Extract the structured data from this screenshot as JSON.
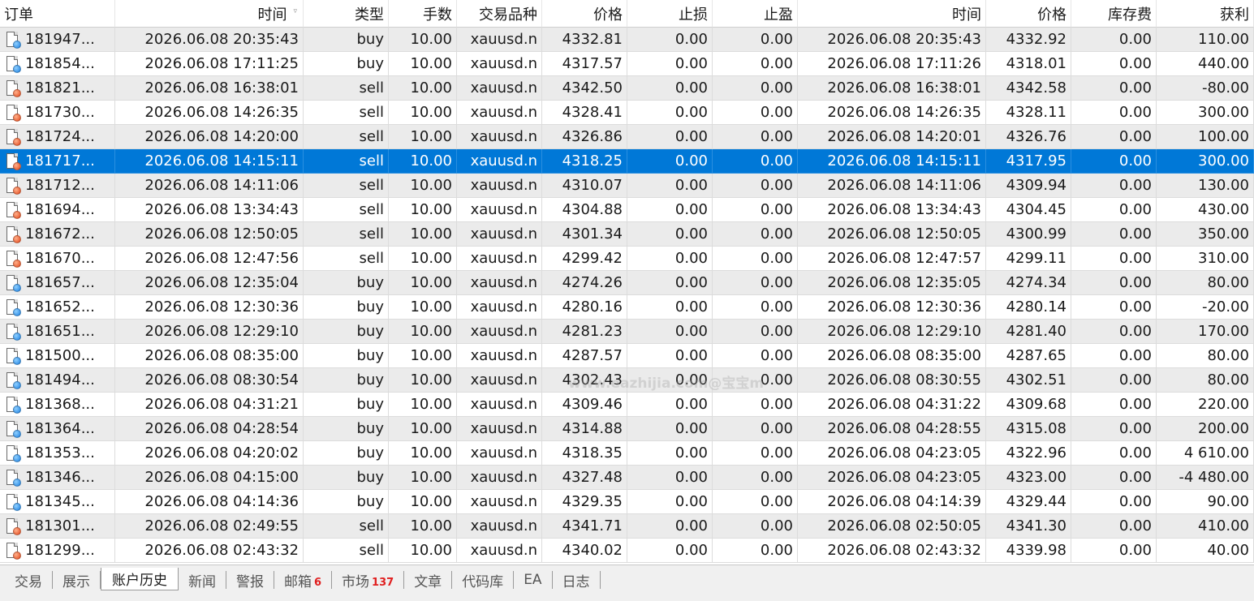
{
  "columns": [
    {
      "key": "order",
      "label": "订单",
      "name": "column-header-order"
    },
    {
      "key": "open_time",
      "label": "时间",
      "name": "column-header-open-time",
      "sort": "▿"
    },
    {
      "key": "type",
      "label": "类型",
      "name": "column-header-type"
    },
    {
      "key": "volume",
      "label": "手数",
      "name": "column-header-volume"
    },
    {
      "key": "symbol",
      "label": "交易品种",
      "name": "column-header-symbol"
    },
    {
      "key": "open_price",
      "label": "价格",
      "name": "column-header-open-price"
    },
    {
      "key": "sl",
      "label": "止损",
      "name": "column-header-stop-loss"
    },
    {
      "key": "tp",
      "label": "止盈",
      "name": "column-header-take-profit"
    },
    {
      "key": "close_time",
      "label": "时间",
      "name": "column-header-close-time"
    },
    {
      "key": "close_price",
      "label": "价格",
      "name": "column-header-close-price"
    },
    {
      "key": "swap",
      "label": "库存费",
      "name": "column-header-swap"
    },
    {
      "key": "profit",
      "label": "获利",
      "name": "column-header-profit"
    }
  ],
  "rows": [
    {
      "order": "181947...",
      "open_time": "2026.06.08 20:35:43",
      "type": "buy",
      "volume": "10.00",
      "symbol": "xauusd.n",
      "open_price": "4332.81",
      "sl": "0.00",
      "tp": "0.00",
      "close_time": "2026.06.08 20:35:43",
      "close_price": "4332.92",
      "swap": "0.00",
      "profit": "110.00"
    },
    {
      "order": "181854...",
      "open_time": "2026.06.08 17:11:25",
      "type": "buy",
      "volume": "10.00",
      "symbol": "xauusd.n",
      "open_price": "4317.57",
      "sl": "0.00",
      "tp": "0.00",
      "close_time": "2026.06.08 17:11:26",
      "close_price": "4318.01",
      "swap": "0.00",
      "profit": "440.00"
    },
    {
      "order": "181821...",
      "open_time": "2026.06.08 16:38:01",
      "type": "sell",
      "volume": "10.00",
      "symbol": "xauusd.n",
      "open_price": "4342.50",
      "sl": "0.00",
      "tp": "0.00",
      "close_time": "2026.06.08 16:38:01",
      "close_price": "4342.58",
      "swap": "0.00",
      "profit": "-80.00"
    },
    {
      "order": "181730...",
      "open_time": "2026.06.08 14:26:35",
      "type": "sell",
      "volume": "10.00",
      "symbol": "xauusd.n",
      "open_price": "4328.41",
      "sl": "0.00",
      "tp": "0.00",
      "close_time": "2026.06.08 14:26:35",
      "close_price": "4328.11",
      "swap": "0.00",
      "profit": "300.00"
    },
    {
      "order": "181724...",
      "open_time": "2026.06.08 14:20:00",
      "type": "sell",
      "volume": "10.00",
      "symbol": "xauusd.n",
      "open_price": "4326.86",
      "sl": "0.00",
      "tp": "0.00",
      "close_time": "2026.06.08 14:20:01",
      "close_price": "4326.76",
      "swap": "0.00",
      "profit": "100.00"
    },
    {
      "order": "181717...",
      "open_time": "2026.06.08 14:15:11",
      "type": "sell",
      "volume": "10.00",
      "symbol": "xauusd.n",
      "open_price": "4318.25",
      "sl": "0.00",
      "tp": "0.00",
      "close_time": "2026.06.08 14:15:11",
      "close_price": "4317.95",
      "swap": "0.00",
      "profit": "300.00",
      "selected": true
    },
    {
      "order": "181712...",
      "open_time": "2026.06.08 14:11:06",
      "type": "sell",
      "volume": "10.00",
      "symbol": "xauusd.n",
      "open_price": "4310.07",
      "sl": "0.00",
      "tp": "0.00",
      "close_time": "2026.06.08 14:11:06",
      "close_price": "4309.94",
      "swap": "0.00",
      "profit": "130.00"
    },
    {
      "order": "181694...",
      "open_time": "2026.06.08 13:34:43",
      "type": "sell",
      "volume": "10.00",
      "symbol": "xauusd.n",
      "open_price": "4304.88",
      "sl": "0.00",
      "tp": "0.00",
      "close_time": "2026.06.08 13:34:43",
      "close_price": "4304.45",
      "swap": "0.00",
      "profit": "430.00"
    },
    {
      "order": "181672...",
      "open_time": "2026.06.08 12:50:05",
      "type": "sell",
      "volume": "10.00",
      "symbol": "xauusd.n",
      "open_price": "4301.34",
      "sl": "0.00",
      "tp": "0.00",
      "close_time": "2026.06.08 12:50:05",
      "close_price": "4300.99",
      "swap": "0.00",
      "profit": "350.00"
    },
    {
      "order": "181670...",
      "open_time": "2026.06.08 12:47:56",
      "type": "sell",
      "volume": "10.00",
      "symbol": "xauusd.n",
      "open_price": "4299.42",
      "sl": "0.00",
      "tp": "0.00",
      "close_time": "2026.06.08 12:47:57",
      "close_price": "4299.11",
      "swap": "0.00",
      "profit": "310.00"
    },
    {
      "order": "181657...",
      "open_time": "2026.06.08 12:35:04",
      "type": "buy",
      "volume": "10.00",
      "symbol": "xauusd.n",
      "open_price": "4274.26",
      "sl": "0.00",
      "tp": "0.00",
      "close_time": "2026.06.08 12:35:05",
      "close_price": "4274.34",
      "swap": "0.00",
      "profit": "80.00"
    },
    {
      "order": "181652...",
      "open_time": "2026.06.08 12:30:36",
      "type": "buy",
      "volume": "10.00",
      "symbol": "xauusd.n",
      "open_price": "4280.16",
      "sl": "0.00",
      "tp": "0.00",
      "close_time": "2026.06.08 12:30:36",
      "close_price": "4280.14",
      "swap": "0.00",
      "profit": "-20.00"
    },
    {
      "order": "181651...",
      "open_time": "2026.06.08 12:29:10",
      "type": "buy",
      "volume": "10.00",
      "symbol": "xauusd.n",
      "open_price": "4281.23",
      "sl": "0.00",
      "tp": "0.00",
      "close_time": "2026.06.08 12:29:10",
      "close_price": "4281.40",
      "swap": "0.00",
      "profit": "170.00"
    },
    {
      "order": "181500...",
      "open_time": "2026.06.08 08:35:00",
      "type": "buy",
      "volume": "10.00",
      "symbol": "xauusd.n",
      "open_price": "4287.57",
      "sl": "0.00",
      "tp": "0.00",
      "close_time": "2026.06.08 08:35:00",
      "close_price": "4287.65",
      "swap": "0.00",
      "profit": "80.00"
    },
    {
      "order": "181494...",
      "open_time": "2026.06.08 08:30:54",
      "type": "buy",
      "volume": "10.00",
      "symbol": "xauusd.n",
      "open_price": "4302.43",
      "sl": "0.00",
      "tp": "0.00",
      "close_time": "2026.06.08 08:30:55",
      "close_price": "4302.51",
      "swap": "0.00",
      "profit": "80.00"
    },
    {
      "order": "181368...",
      "open_time": "2026.06.08 04:31:21",
      "type": "buy",
      "volume": "10.00",
      "symbol": "xauusd.n",
      "open_price": "4309.46",
      "sl": "0.00",
      "tp": "0.00",
      "close_time": "2026.06.08 04:31:22",
      "close_price": "4309.68",
      "swap": "0.00",
      "profit": "220.00"
    },
    {
      "order": "181364...",
      "open_time": "2026.06.08 04:28:54",
      "type": "buy",
      "volume": "10.00",
      "symbol": "xauusd.n",
      "open_price": "4314.88",
      "sl": "0.00",
      "tp": "0.00",
      "close_time": "2026.06.08 04:28:55",
      "close_price": "4315.08",
      "swap": "0.00",
      "profit": "200.00"
    },
    {
      "order": "181353...",
      "open_time": "2026.06.08 04:20:02",
      "type": "buy",
      "volume": "10.00",
      "symbol": "xauusd.n",
      "open_price": "4318.35",
      "sl": "0.00",
      "tp": "0.00",
      "close_time": "2026.06.08 04:23:05",
      "close_price": "4322.96",
      "swap": "0.00",
      "profit": "4 610.00"
    },
    {
      "order": "181346...",
      "open_time": "2026.06.08 04:15:00",
      "type": "buy",
      "volume": "10.00",
      "symbol": "xauusd.n",
      "open_price": "4327.48",
      "sl": "0.00",
      "tp": "0.00",
      "close_time": "2026.06.08 04:23:05",
      "close_price": "4323.00",
      "swap": "0.00",
      "profit": "-4 480.00"
    },
    {
      "order": "181345...",
      "open_time": "2026.06.08 04:14:36",
      "type": "buy",
      "volume": "10.00",
      "symbol": "xauusd.n",
      "open_price": "4329.35",
      "sl": "0.00",
      "tp": "0.00",
      "close_time": "2026.06.08 04:14:39",
      "close_price": "4329.44",
      "swap": "0.00",
      "profit": "90.00"
    },
    {
      "order": "181301...",
      "open_time": "2026.06.08 02:49:55",
      "type": "sell",
      "volume": "10.00",
      "symbol": "xauusd.n",
      "open_price": "4341.71",
      "sl": "0.00",
      "tp": "0.00",
      "close_time": "2026.06.08 02:50:05",
      "close_price": "4341.30",
      "swap": "0.00",
      "profit": "410.00"
    },
    {
      "order": "181299...",
      "open_time": "2026.06.08 02:43:32",
      "type": "sell",
      "volume": "10.00",
      "symbol": "xauusd.n",
      "open_price": "4340.02",
      "sl": "0.00",
      "tp": "0.00",
      "close_time": "2026.06.08 02:43:32",
      "close_price": "4339.98",
      "swap": "0.00",
      "profit": "40.00"
    }
  ],
  "icons": {
    "buy": "buy-order-icon",
    "sell": "sell-order-icon"
  },
  "colors": {
    "selected_row": "#0078d7",
    "buy_dot": "#1c7fe0",
    "sell_dot": "#e2461a",
    "badge": "#e02020"
  },
  "watermark": "www.eazhijia.com@宝宝m",
  "tabs": [
    {
      "label": "交易",
      "name": "tab-trade"
    },
    {
      "label": "展示",
      "name": "tab-exposure"
    },
    {
      "label": "账户历史",
      "name": "tab-account-history",
      "active": true
    },
    {
      "label": "新闻",
      "name": "tab-news"
    },
    {
      "label": "警报",
      "name": "tab-alerts"
    },
    {
      "label": "邮箱",
      "name": "tab-mailbox",
      "badge": "6"
    },
    {
      "label": "市场",
      "name": "tab-market",
      "badge": "137"
    },
    {
      "label": "文章",
      "name": "tab-articles"
    },
    {
      "label": "代码库",
      "name": "tab-code-base"
    },
    {
      "label": "EA",
      "name": "tab-ea"
    },
    {
      "label": "日志",
      "name": "tab-journal"
    }
  ]
}
